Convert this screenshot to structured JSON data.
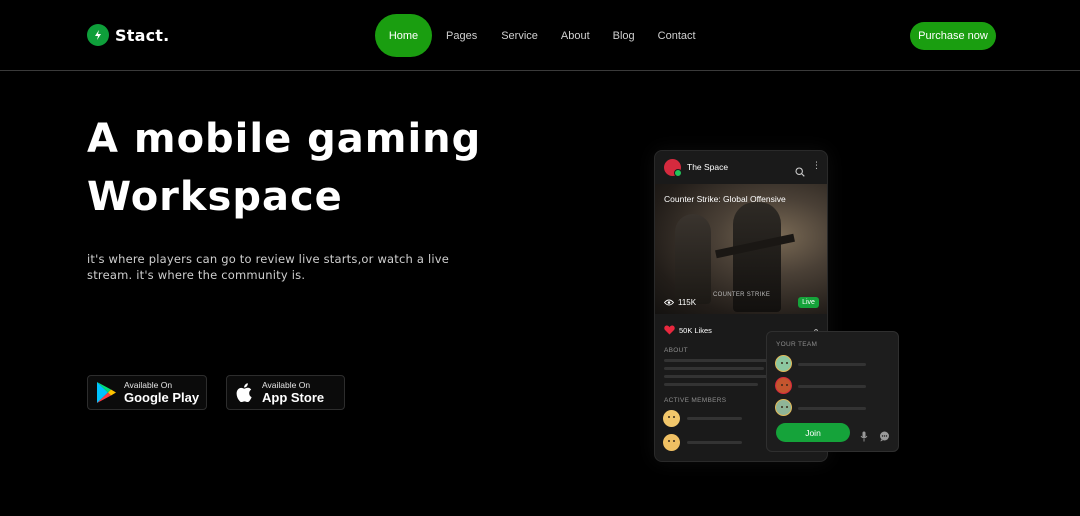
{
  "brand": {
    "name": "Stact.",
    "accent": "#1a9e10"
  },
  "nav": {
    "items": [
      {
        "label": "Home",
        "active": true
      },
      {
        "label": "Pages"
      },
      {
        "label": "Service"
      },
      {
        "label": "About"
      },
      {
        "label": "Blog"
      },
      {
        "label": "Contact"
      }
    ],
    "cta": "Purchase now"
  },
  "hero": {
    "title_line1": "A mobile gaming",
    "title_line2": "Workspace",
    "subtitle": "it's where players can go to review live starts,or watch a live stream. it's where the community is."
  },
  "stores": {
    "google": {
      "small": "Available On",
      "big": "Google Play",
      "icon": "google-play-icon"
    },
    "apple": {
      "small": "Available On",
      "big": "App Store",
      "icon": "apple-icon"
    }
  },
  "phone": {
    "channel": "The Space",
    "video_title": "Counter Strike: Global Offensive",
    "views": "115K",
    "watermark": "COUNTER STRIKE",
    "live": "Live",
    "likes": "50K Likes",
    "about": "ABOUT",
    "active_members": "ACTIVE MEMBERS"
  },
  "team": {
    "title": "YOUR TEAM",
    "join": "Join"
  }
}
